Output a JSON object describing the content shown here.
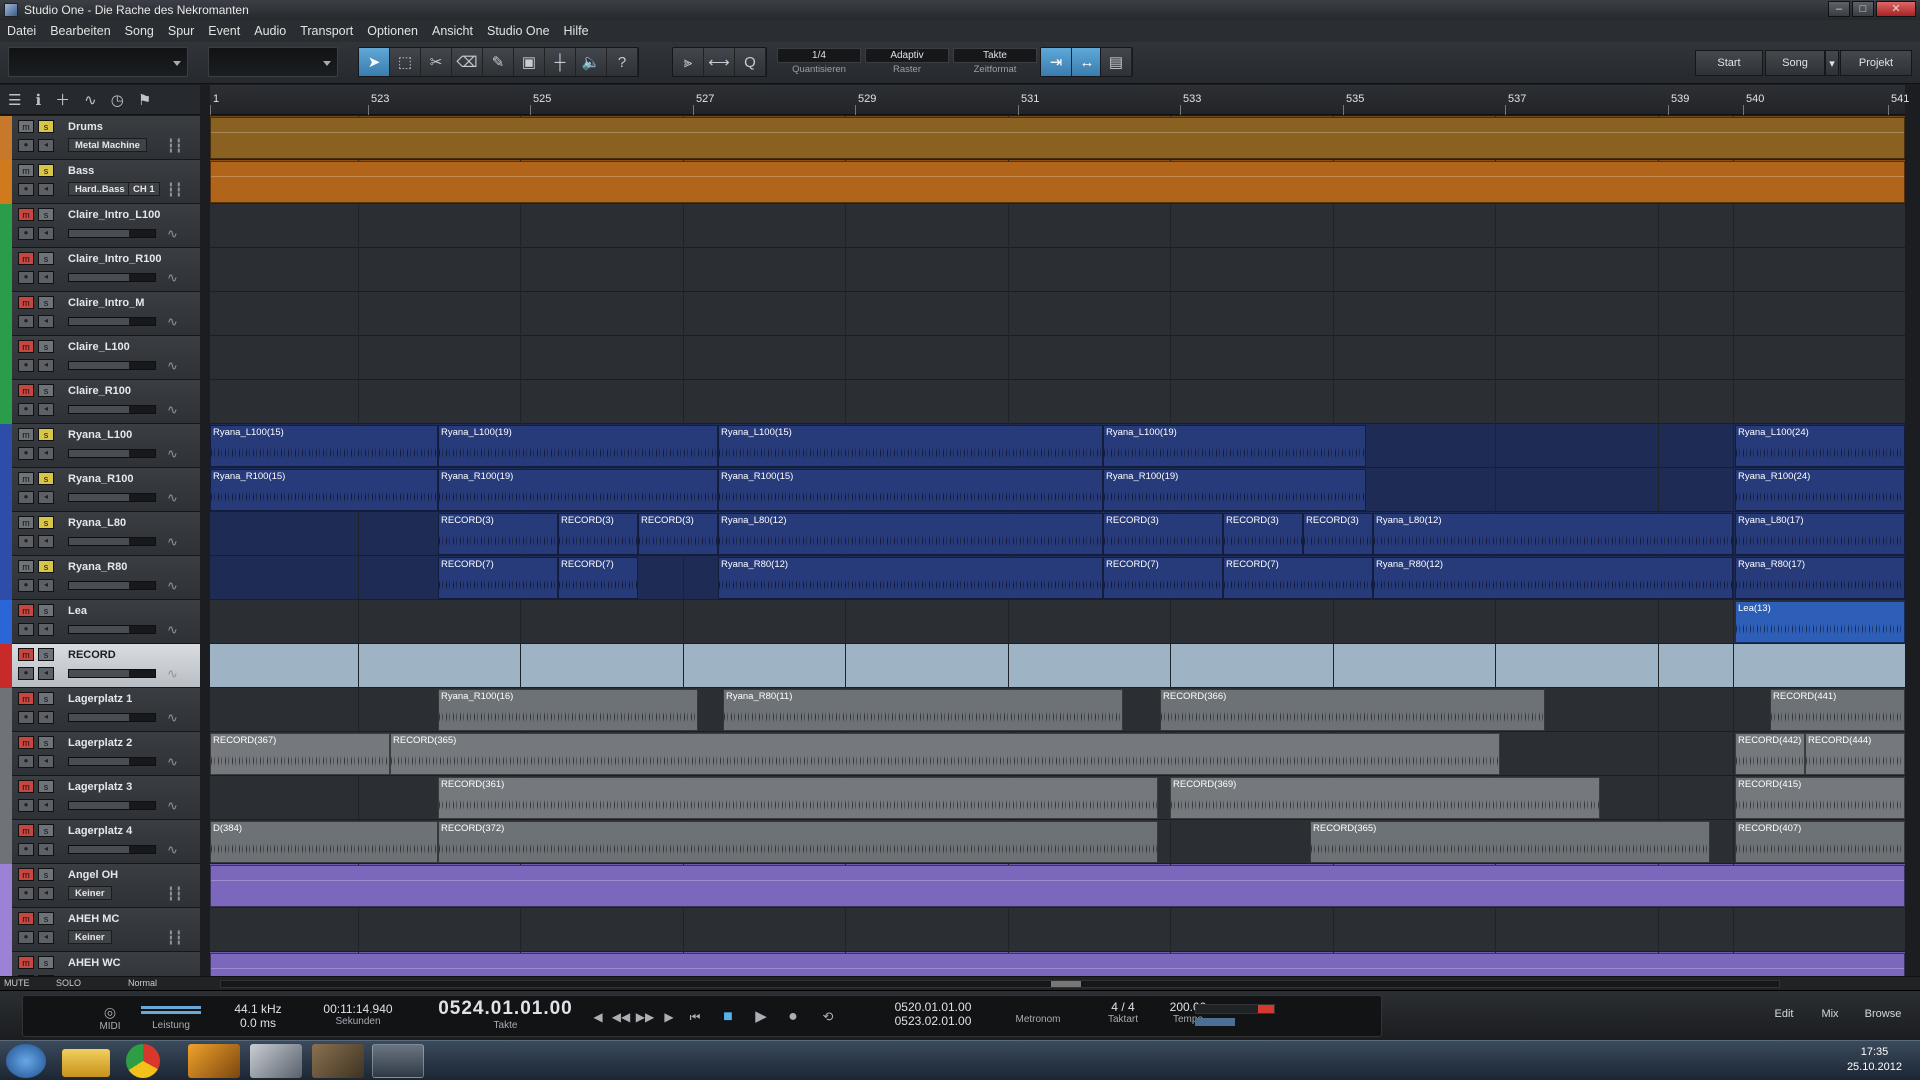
{
  "window": {
    "title": "Studio One - Die Rache des Nekromanten"
  },
  "menu": [
    "Datei",
    "Bearbeiten",
    "Song",
    "Spur",
    "Event",
    "Audio",
    "Transport",
    "Optionen",
    "Ansicht",
    "Studio One",
    "Hilfe"
  ],
  "toolbar": {
    "quantize": {
      "value": "1/4",
      "label": "Quantisieren"
    },
    "raster": {
      "value": "Adaptiv",
      "label": "Raster"
    },
    "timeformat": {
      "value": "Takte",
      "label": "Zeitformat"
    },
    "pages": [
      "Start",
      "Song",
      "Projekt"
    ]
  },
  "ruler": {
    "marks": [
      "1",
      "523",
      "525",
      "527",
      "529",
      "531",
      "533",
      "535",
      "537",
      "539",
      "540",
      "541"
    ]
  },
  "tracks": [
    {
      "name": "Drums",
      "mute": false,
      "solo": true,
      "inst": "Metal Machine",
      "color": "#c8782a",
      "type": "instrument"
    },
    {
      "name": "Bass",
      "mute": false,
      "solo": true,
      "inst": "Hard..Bass",
      "ch": "CH 1",
      "color": "#d07a1e",
      "type": "instrument"
    },
    {
      "name": "Claire_Intro_L100",
      "mute": true,
      "solo": false,
      "color": "#2a9d4a",
      "type": "audio"
    },
    {
      "name": "Claire_Intro_R100",
      "mute": true,
      "solo": false,
      "color": "#2a9d4a",
      "type": "audio"
    },
    {
      "name": "Claire_Intro_M",
      "mute": true,
      "solo": false,
      "color": "#2a9d4a",
      "type": "audio"
    },
    {
      "name": "Claire_L100",
      "mute": true,
      "solo": false,
      "color": "#2a9d4a",
      "type": "audio"
    },
    {
      "name": "Claire_R100",
      "mute": true,
      "solo": false,
      "color": "#2a9d4a",
      "type": "audio"
    },
    {
      "name": "Ryana_L100",
      "mute": false,
      "solo": true,
      "color": "#2c4ea8",
      "type": "audio"
    },
    {
      "name": "Ryana_R100",
      "mute": false,
      "solo": true,
      "color": "#2c4ea8",
      "type": "audio"
    },
    {
      "name": "Ryana_L80",
      "mute": false,
      "solo": true,
      "color": "#2c4ea8",
      "type": "audio"
    },
    {
      "name": "Ryana_R80",
      "mute": false,
      "solo": true,
      "color": "#2c4ea8",
      "type": "audio"
    },
    {
      "name": "Lea",
      "mute": true,
      "solo": false,
      "color": "#2a66d8",
      "type": "audio"
    },
    {
      "name": "RECORD",
      "mute": true,
      "solo": false,
      "color": "#c82a2a",
      "type": "audio",
      "selected": true
    },
    {
      "name": "Lagerplatz 1",
      "mute": true,
      "solo": false,
      "color": "#6e7378",
      "type": "audio"
    },
    {
      "name": "Lagerplatz 2",
      "mute": true,
      "solo": false,
      "color": "#6e7378",
      "type": "audio"
    },
    {
      "name": "Lagerplatz 3",
      "mute": true,
      "solo": false,
      "color": "#6e7378",
      "type": "audio"
    },
    {
      "name": "Lagerplatz 4",
      "mute": true,
      "solo": false,
      "color": "#6e7378",
      "type": "audio"
    },
    {
      "name": "Angel OH",
      "mute": true,
      "solo": false,
      "inst": "Keiner",
      "color": "#9b82d6",
      "type": "instrument"
    },
    {
      "name": "AHEH MC",
      "mute": true,
      "solo": false,
      "inst": "Keiner",
      "color": "#9b82d6",
      "type": "instrument"
    },
    {
      "name": "AHEH WC",
      "mute": true,
      "solo": false,
      "color": "#9b82d6",
      "type": "instrument"
    }
  ],
  "events": [
    {
      "lane": 7,
      "label": "Ryana_L100(15)"
    },
    {
      "lane": 7,
      "label": "Ryana_L100(19)"
    },
    {
      "lane": 7,
      "label": "Ryana_L100(15)"
    },
    {
      "lane": 7,
      "label": "Ryana_L100(19)"
    },
    {
      "lane": 7,
      "label": "Ryana_L100(24)"
    },
    {
      "lane": 8,
      "label": "Ryana_R100(15)"
    },
    {
      "lane": 8,
      "label": "Ryana_R100(19)"
    },
    {
      "lane": 8,
      "label": "Ryana_R100(15)"
    },
    {
      "lane": 8,
      "label": "Ryana_R100(19)"
    },
    {
      "lane": 8,
      "label": "Ryana_R100(24)"
    },
    {
      "lane": 9,
      "label": "RECORD(3)"
    },
    {
      "lane": 9,
      "label": "RECORD(3)"
    },
    {
      "lane": 9,
      "label": "RECORD(3)"
    },
    {
      "lane": 9,
      "label": "Ryana_L80(12)"
    },
    {
      "lane": 9,
      "label": "RECORD(3)"
    },
    {
      "lane": 9,
      "label": "RECORD(3)"
    },
    {
      "lane": 9,
      "label": "RECORD(3)"
    },
    {
      "lane": 9,
      "label": "Ryana_L80(12)"
    },
    {
      "lane": 9,
      "label": "Ryana_L80(17)"
    },
    {
      "lane": 10,
      "label": "RECORD(7)"
    },
    {
      "lane": 10,
      "label": "RECORD(7)"
    },
    {
      "lane": 10,
      "label": "Ryana_R80(12)"
    },
    {
      "lane": 10,
      "label": "RECORD(7)"
    },
    {
      "lane": 10,
      "label": "RECORD(7)"
    },
    {
      "lane": 10,
      "label": "Ryana_R80(12)"
    },
    {
      "lane": 10,
      "label": "Ryana_R80(17)"
    },
    {
      "lane": 11,
      "label": "Lea(13)"
    },
    {
      "lane": 13,
      "label": "Ryana_R100(16)"
    },
    {
      "lane": 13,
      "label": "Ryana_R80(11)"
    },
    {
      "lane": 13,
      "label": "RECORD(366)"
    },
    {
      "lane": 13,
      "label": "RECORD(441)"
    },
    {
      "lane": 14,
      "label": "RECORD(367)"
    },
    {
      "lane": 14,
      "label": "RECORD(365)"
    },
    {
      "lane": 14,
      "label": "RECORD(442)"
    },
    {
      "lane": 14,
      "label": "RECORD(444)"
    },
    {
      "lane": 15,
      "label": "RECORD(361)"
    },
    {
      "lane": 15,
      "label": "RECORD(369)"
    },
    {
      "lane": 15,
      "label": "RECORD(415)"
    },
    {
      "lane": 16,
      "label": "D(384)"
    },
    {
      "lane": 16,
      "label": "RECORD(372)"
    },
    {
      "lane": 16,
      "label": "RECORD(365)"
    },
    {
      "lane": 16,
      "label": "RECORD(407)"
    }
  ],
  "statusrow": {
    "mute": "MUTE",
    "solo": "SOLO",
    "mode": "Normal"
  },
  "transport": {
    "midi": "MIDI",
    "leistung": "Leistung",
    "samplerate": "44.1 kHz",
    "latency": "0.0 ms",
    "seconds": "00:11:14.940",
    "seconds_label": "Sekunden",
    "position": "0524.01.01.00",
    "position_label": "Takte",
    "loop_start": "0520.01.01.00",
    "loop_end": "0523.02.01.00",
    "metronome_label": "Metronom",
    "sig_num": "4",
    "sig_den": "4",
    "sig_label": "Taktart",
    "tempo": "200.00",
    "tempo_label": "Tempo",
    "views": [
      "Edit",
      "Mix",
      "Browse"
    ]
  },
  "taskbar": {
    "time": "17:35",
    "date": "25.10.2012"
  }
}
